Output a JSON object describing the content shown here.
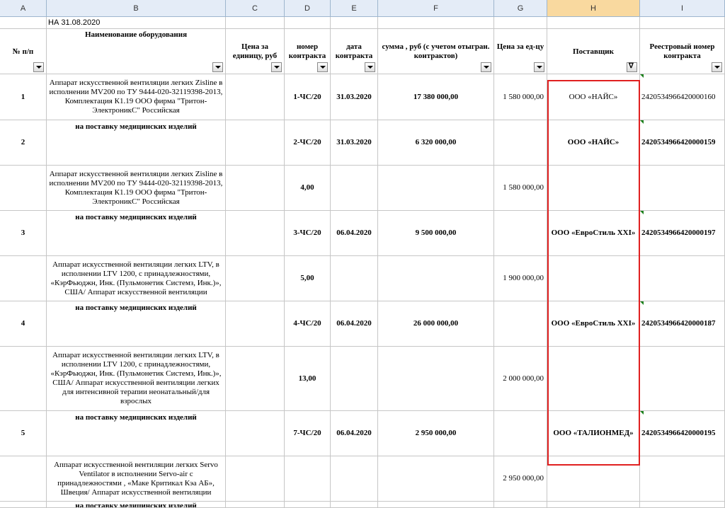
{
  "columns": [
    "A",
    "B",
    "C",
    "D",
    "E",
    "F",
    "G",
    "H",
    "I"
  ],
  "title_cell": "НА 31.08.2020",
  "headers": {
    "num": "№ п/п",
    "name": "Наименование оборудования",
    "price": "Цена за единицу, руб",
    "contract_no": "номер контракта",
    "contract_date": "дата контракта",
    "sum": "сумма , руб (с учетом отыгран. контрактов)",
    "unit_price": "Цена за ед-цу",
    "supplier": "Поставщик",
    "registry": "Реестровый номер контракта"
  },
  "rows": [
    {
      "num": "1",
      "name": "Аппарат искусственной вентиляции легких Zisline в исполнении MV200 по ТУ 9444-020-32119398-2013, Комплектация К1.19 ООО фирма \"Тритон-ЭлектроникС\" Российская",
      "contract_no": "1-ЧС/20",
      "date": "31.03.2020",
      "sum": "17 380 000,00",
      "unit": "1 580 000,00",
      "supplier": "ООО «НАЙС»",
      "registry": "2420534966420000160"
    },
    {
      "num": "2",
      "name": "на поставку медицинских изделий",
      "contract_no": "2-ЧС/20",
      "date": "31.03.2020",
      "sum": "6 320 000,00",
      "unit": "",
      "supplier": "ООО «НАЙС»",
      "registry": "2420534966420000159"
    },
    {
      "num": "",
      "name": "Аппарат искусственной вентиляции легких Zisline в исполнении MV200 по ТУ 9444-020-32119398-2013, Комплектация К1.19 ООО фирма \"Тритон-ЭлектроникС\" Российская",
      "contract_no": "4,00",
      "date": "",
      "sum": "",
      "unit": "1 580 000,00",
      "supplier": "",
      "registry": ""
    },
    {
      "num": "3",
      "name": "на поставку медицинских изделий",
      "contract_no": "3-ЧС/20",
      "date": "06.04.2020",
      "sum": "9 500 000,00",
      "unit": "",
      "supplier": "ООО «ЕвроСтиль XXI»",
      "registry": "2420534966420000197"
    },
    {
      "num": "",
      "name": "Аппарат искусственной вентиляции легких LTV, в исполнении LTV 1200, с принадлежностями, «КэрФьюджн, Инк. (Пульмонетик Системз, Инк.)», США/ Аппарат искусственной вентиляции",
      "contract_no": "5,00",
      "date": "",
      "sum": "",
      "unit": "1 900 000,00",
      "supplier": "",
      "registry": ""
    },
    {
      "num": "4",
      "name": "на поставку медицинских изделий",
      "contract_no": "4-ЧС/20",
      "date": "06.04.2020",
      "sum": "26 000 000,00",
      "unit": "",
      "supplier": "ООО «ЕвроСтиль XXI»",
      "registry": "2420534966420000187"
    },
    {
      "num": "",
      "name": "Аппарат искусственной вентиляции легких LTV, в исполнении LTV 1200, с принадлежностями, «КэрФьюджн, Инк. (Пульмонетик Системз, Инк.)», США/ Аппарат искусственной вентиляции легких для интенсивной терапии неонатальный/для взрослых",
      "contract_no": "13,00",
      "date": "",
      "sum": "",
      "unit": "2 000 000,00",
      "supplier": "",
      "registry": ""
    },
    {
      "num": "5",
      "name": "на поставку медицинских изделий",
      "contract_no": "7-ЧС/20",
      "date": "06.04.2020",
      "sum": "2 950 000,00",
      "unit": "",
      "supplier": "ООО «ТАЛИОНМЕД»",
      "registry": "2420534966420000195"
    },
    {
      "num": "",
      "name": "Аппарат искусственной вентиляции легких Servo Ventilator в исполнении Servo-air с принадлежностями , «Маке Критикал Кэа АБ», Швеция/ Аппарат искусственной вентиляции",
      "contract_no": "",
      "date": "",
      "sum": "",
      "unit": "2 950 000,00",
      "supplier": "",
      "registry": ""
    },
    {
      "num": "",
      "name": "на поставку медицинских изделий",
      "contract_no": "",
      "date": "",
      "sum": "",
      "unit": "",
      "supplier": "",
      "registry": ""
    }
  ]
}
